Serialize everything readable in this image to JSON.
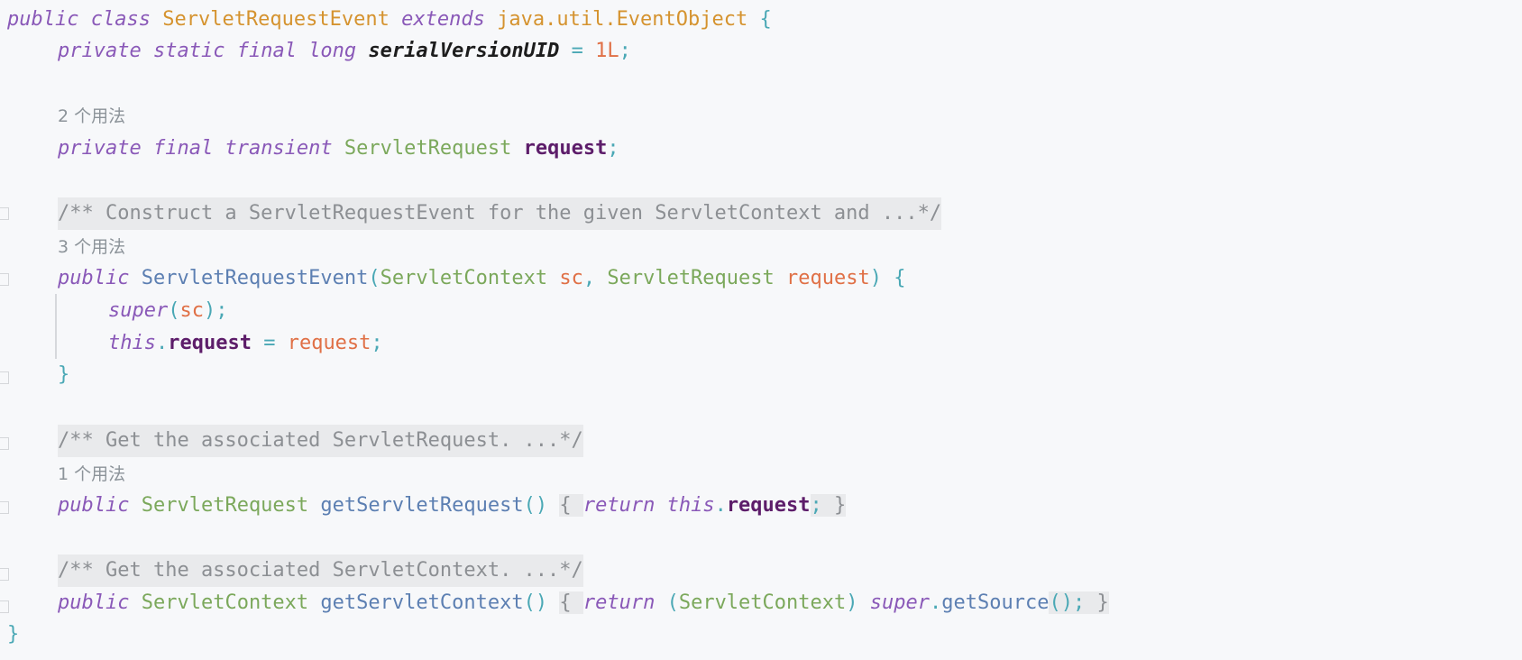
{
  "code": {
    "class_line": {
      "kw_public": "public",
      "kw_class": "class",
      "class_name": "ServletRequestEvent",
      "kw_extends": "extends",
      "pkg": "java.util.",
      "super_name": "EventObject",
      "brace": "{"
    },
    "serial_line": {
      "kw_private": "private",
      "kw_static": "static",
      "kw_final": "final",
      "kw_long": "long",
      "field": "serialVersionUID",
      "eq": "=",
      "value": "1L",
      "semi": ";"
    },
    "usage_2": "2 个用法",
    "field_line": {
      "kw_private": "private",
      "kw_final": "final",
      "kw_transient": "transient",
      "type": "ServletRequest",
      "field": "request",
      "semi": ";"
    },
    "doc_ctor": "/** Construct a ServletRequestEvent for the given ServletContext and ...*/",
    "usage_3": "3 个用法",
    "ctor_line": {
      "kw_public": "public",
      "name": "ServletRequestEvent",
      "open": "(",
      "t1": "ServletContext",
      "p1": "sc",
      "comma": ",",
      "t2": "ServletRequest",
      "p2": "request",
      "close": ")",
      "brace": "{"
    },
    "super_line": {
      "kw_super": "super",
      "open": "(",
      "arg": "sc",
      "close": ");"
    },
    "assign_line": {
      "kw_this": "this",
      "dot": ".",
      "field": "request",
      "eq": "=",
      "value": "request",
      "semi": ";"
    },
    "ctor_close": "}",
    "doc_get_request": "/** Get the associated ServletRequest. ...*/",
    "usage_1": "1 个用法",
    "get_request_line": {
      "kw_public": "public",
      "type": "ServletRequest",
      "name": "getServletRequest",
      "parens": "()",
      "open_brace": "{",
      "kw_return": "return",
      "kw_this": "this",
      "dot": ".",
      "field": "request",
      "semi": ";",
      "close_brace": "}"
    },
    "doc_get_context": "/** Get the associated ServletContext. ...*/",
    "get_context_line": {
      "kw_public": "public",
      "type": "ServletContext",
      "name": "getServletContext",
      "parens": "()",
      "open_brace": "{",
      "kw_return": "return",
      "cast_open": "(",
      "cast_type": "ServletContext",
      "cast_close": ")",
      "kw_super": "super",
      "dot": ".",
      "call": "getSource",
      "call_end": "();",
      "close_brace": "}"
    },
    "class_close": "}"
  }
}
